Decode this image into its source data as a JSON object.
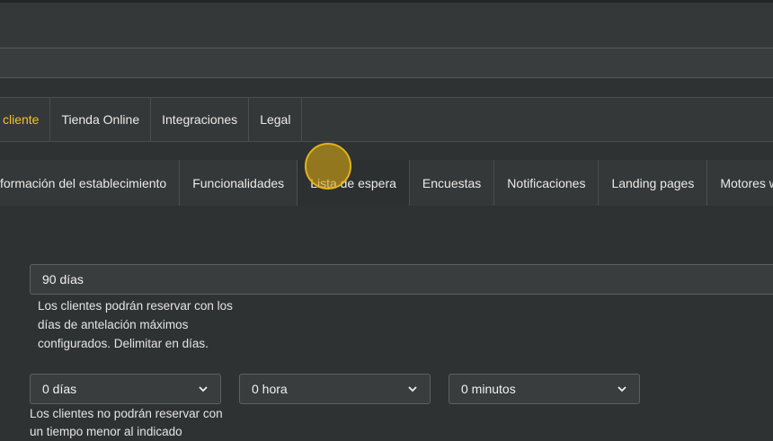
{
  "tabs_primary": [
    {
      "label": "cliente",
      "active": true
    },
    {
      "label": "Tienda Online",
      "active": false
    },
    {
      "label": "Integraciones",
      "active": false
    },
    {
      "label": "Legal",
      "active": false
    }
  ],
  "tabs_secondary": [
    {
      "label": "formación del establecimiento",
      "active": false
    },
    {
      "label": "Funcionalidades",
      "active": false
    },
    {
      "label": "Lista de espera",
      "active": true
    },
    {
      "label": "Encuestas",
      "active": false
    },
    {
      "label": "Notificaciones",
      "active": false
    },
    {
      "label": "Landing pages",
      "active": false
    },
    {
      "label": "Motores web",
      "active": false
    }
  ],
  "advance_booking": {
    "value": "90 días",
    "help": "Los clientes podrán reservar con los días de antelación máximos configurados. Delimitar en días."
  },
  "min_booking": {
    "days": "0 días",
    "hours": "0 hora",
    "minutes": "0 minutos",
    "help": "Los clientes no podrán reservar con un tiempo menor al indicado"
  },
  "colors": {
    "accent": "#f2c230",
    "background": "#2f3233",
    "panel": "#353838"
  }
}
